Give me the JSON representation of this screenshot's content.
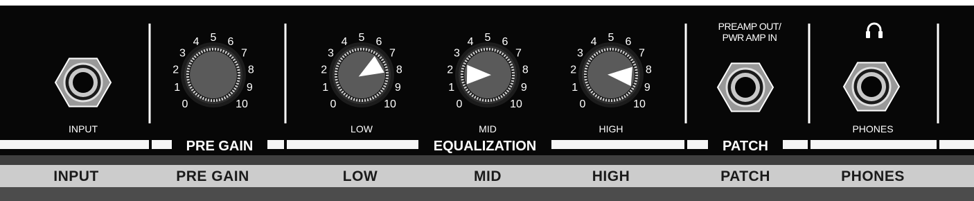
{
  "jacks": {
    "input_label": "INPUT",
    "patch_label_line1": "PREAMP OUT/",
    "patch_label_line2": "PWR AMP IN",
    "phones_label": "PHONES"
  },
  "dial_numbers": [
    "0",
    "1",
    "2",
    "3",
    "4",
    "5",
    "6",
    "7",
    "8",
    "9",
    "10"
  ],
  "knobs": {
    "pre_gain": {
      "sublabel": "",
      "level": null
    },
    "low": {
      "sublabel": "LOW",
      "level": 0.72
    },
    "mid": {
      "sublabel": "MID",
      "level": 0.17
    },
    "high": {
      "sublabel": "HIGH",
      "level": 0.85
    }
  },
  "sections": {
    "pre_gain": "PRE GAIN",
    "equalization": "EQUALIZATION",
    "patch": "PATCH"
  },
  "bottom_labels": [
    "INPUT",
    "PRE GAIN",
    "LOW",
    "MID",
    "HIGH",
    "PATCH",
    "PHONES"
  ],
  "colors": {
    "panel": "#070707",
    "knob": "#5a5a5a",
    "pointer": "#ffffff",
    "label_bar": "#cccccc",
    "footer": "#4c4c4c",
    "stripe": "#3f3f3f"
  },
  "icons": {
    "phones": "headphones-icon"
  }
}
